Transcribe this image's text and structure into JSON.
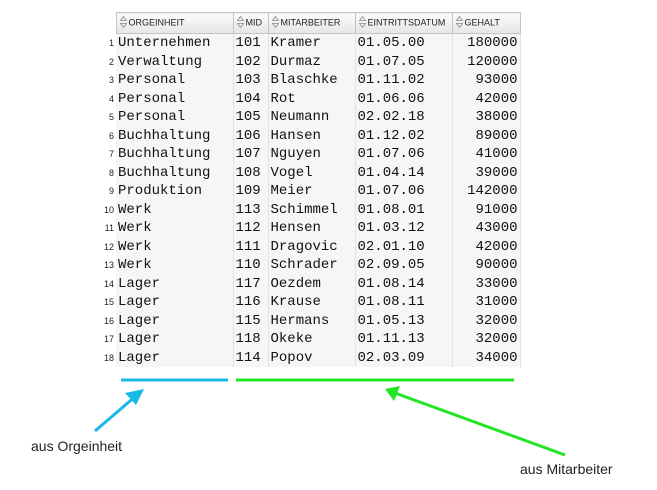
{
  "table": {
    "columns": [
      {
        "label": "ORGEINHEIT",
        "align": "left"
      },
      {
        "label": "MID",
        "align": "left"
      },
      {
        "label": "MITARBEITER",
        "align": "left"
      },
      {
        "label": "EINTRITTSDATUM",
        "align": "left"
      },
      {
        "label": "GEHALT",
        "align": "right"
      }
    ],
    "rows": [
      [
        "1",
        "Unternehmen",
        "101",
        "Kramer",
        "01.05.00",
        "180000"
      ],
      [
        "2",
        "Verwaltung",
        "102",
        "Durmaz",
        "01.07.05",
        "120000"
      ],
      [
        "3",
        "Personal",
        "103",
        "Blaschke",
        "01.11.02",
        "93000"
      ],
      [
        "4",
        "Personal",
        "104",
        "Rot",
        "01.06.06",
        "42000"
      ],
      [
        "5",
        "Personal",
        "105",
        "Neumann",
        "02.02.18",
        "38000"
      ],
      [
        "6",
        "Buchhaltung",
        "106",
        "Hansen",
        "01.12.02",
        "89000"
      ],
      [
        "7",
        "Buchhaltung",
        "107",
        "Nguyen",
        "01.07.06",
        "41000"
      ],
      [
        "8",
        "Buchhaltung",
        "108",
        "Vogel",
        "01.04.14",
        "39000"
      ],
      [
        "9",
        "Produktion",
        "109",
        "Meier",
        "01.07.06",
        "142000"
      ],
      [
        "10",
        "Werk",
        "113",
        "Schimmel",
        "01.08.01",
        "91000"
      ],
      [
        "11",
        "Werk",
        "112",
        "Hensen",
        "01.03.12",
        "43000"
      ],
      [
        "12",
        "Werk",
        "111",
        "Dragovic",
        "02.01.10",
        "42000"
      ],
      [
        "13",
        "Werk",
        "110",
        "Schrader",
        "02.09.05",
        "90000"
      ],
      [
        "14",
        "Lager",
        "117",
        "Oezdem",
        "01.08.14",
        "33000"
      ],
      [
        "15",
        "Lager",
        "116",
        "Krause",
        "01.08.11",
        "31000"
      ],
      [
        "16",
        "Lager",
        "115",
        "Hermans",
        "01.05.13",
        "32000"
      ],
      [
        "17",
        "Lager",
        "118",
        "Okeke",
        "01.11.13",
        "32000"
      ],
      [
        "18",
        "Lager",
        "114",
        "Popov",
        "02.03.09",
        "34000"
      ]
    ]
  },
  "annotations": {
    "orgeinheit_label": "aus Orgeinheit",
    "mitarbeiter_label": "aus Mitarbeiter",
    "blue_color": "#17b9e6",
    "green_color": "#22e622"
  }
}
